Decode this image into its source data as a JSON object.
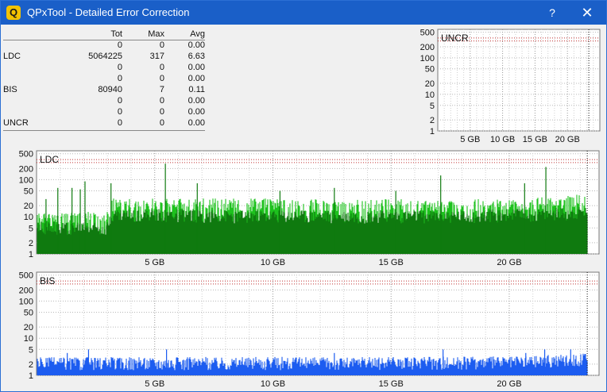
{
  "window": {
    "title": "QPxTool - Detailed Error Correction",
    "app_icon_glyph": "Q",
    "help_glyph": "?",
    "close_glyph": "✕",
    "titlebar_color": "#1a5fc8"
  },
  "stats": {
    "headers": [
      "Tot",
      "Max",
      "Avg"
    ],
    "rows": [
      {
        "label": "",
        "tot": "0",
        "max": "0",
        "avg": "0.00"
      },
      {
        "label": "LDC",
        "tot": "5064225",
        "max": "317",
        "avg": "6.63"
      },
      {
        "label": "",
        "tot": "0",
        "max": "0",
        "avg": "0.00"
      },
      {
        "label": "",
        "tot": "0",
        "max": "0",
        "avg": "0.00"
      },
      {
        "label": "BIS",
        "tot": "80940",
        "max": "7",
        "avg": "0.11"
      },
      {
        "label": "",
        "tot": "0",
        "max": "0",
        "avg": "0.00"
      },
      {
        "label": "",
        "tot": "0",
        "max": "0",
        "avg": "0.00"
      },
      {
        "label": "UNCR",
        "tot": "0",
        "max": "0",
        "avg": "0.00"
      }
    ]
  },
  "chart_data": [
    {
      "id": "uncr",
      "type": "area",
      "title": "UNCR",
      "y_scale": "log",
      "y_ticks": [
        "1",
        "2",
        "5",
        "10",
        "20",
        "50",
        "100",
        "200",
        "500"
      ],
      "x_ticks": [
        "5 GB",
        "10 GB",
        "15 GB",
        "20 GB"
      ],
      "x_unit": "GB",
      "x_range": [
        0,
        25
      ],
      "disc_end_gb": 23.3,
      "series": [
        {
          "values": [],
          "color": "#1aa31a"
        }
      ]
    },
    {
      "id": "ldc",
      "type": "area",
      "title": "LDC",
      "y_scale": "log",
      "y_ticks": [
        "1",
        "2",
        "5",
        "10",
        "20",
        "50",
        "100",
        "200",
        "500"
      ],
      "x_ticks": [
        "5 GB",
        "10 GB",
        "15 GB",
        "20 GB"
      ],
      "x_unit": "GB",
      "x_range": [
        0,
        23.8
      ],
      "disc_end_gb": 23.3,
      "series": [
        {
          "role": "max",
          "color": "#1ec21e",
          "x": [
            0,
            1,
            2,
            3,
            3.2,
            4,
            6,
            8,
            10,
            12,
            14,
            16,
            18,
            20,
            21,
            22,
            23,
            23.3
          ],
          "values": [
            10,
            10,
            11,
            11,
            25,
            25,
            25,
            25,
            25,
            25,
            25,
            24,
            24,
            24,
            26,
            28,
            32,
            34
          ]
        },
        {
          "role": "avg",
          "color": "#0f7a0f",
          "x": [
            0,
            1,
            2,
            3,
            3.2,
            4,
            6,
            8,
            10,
            12,
            14,
            16,
            18,
            20,
            21,
            22,
            23,
            23.3
          ],
          "values": [
            6,
            6,
            6,
            6,
            13,
            13,
            13,
            12,
            12,
            12,
            12,
            12,
            12,
            13,
            13,
            14,
            15,
            15
          ]
        }
      ],
      "spikes": [
        {
          "x": 0.4,
          "value": 30
        },
        {
          "x": 0.9,
          "value": 60
        },
        {
          "x": 1.5,
          "value": 60
        },
        {
          "x": 1.85,
          "value": 55
        },
        {
          "x": 2.05,
          "value": 90
        },
        {
          "x": 3.15,
          "value": 80
        },
        {
          "x": 5.45,
          "value": 270
        },
        {
          "x": 6.8,
          "value": 80
        },
        {
          "x": 10.3,
          "value": 50
        },
        {
          "x": 12.6,
          "value": 60
        },
        {
          "x": 15.2,
          "value": 50
        },
        {
          "x": 17.1,
          "value": 130
        },
        {
          "x": 20.65,
          "value": 80
        },
        {
          "x": 21.55,
          "value": 220
        }
      ]
    },
    {
      "id": "bis",
      "type": "area",
      "title": "BIS",
      "y_scale": "log",
      "y_ticks": [
        "1",
        "2",
        "5",
        "10",
        "20",
        "50",
        "100",
        "200",
        "500"
      ],
      "x_ticks": [
        "5 GB",
        "10 GB",
        "15 GB",
        "20 GB"
      ],
      "x_unit": "GB",
      "x_range": [
        0,
        23.8
      ],
      "disc_end_gb": 23.3,
      "series": [
        {
          "color": "#1c5cf0",
          "x": [
            0,
            5,
            10,
            15,
            20,
            22,
            23.3
          ],
          "values": [
            2.5,
            2.5,
            2.5,
            2.5,
            2.6,
            3,
            3.2
          ]
        }
      ],
      "spikes": [
        {
          "x": 1.3,
          "value": 4
        },
        {
          "x": 2.2,
          "value": 5
        },
        {
          "x": 5.5,
          "value": 5
        },
        {
          "x": 12.6,
          "value": 4
        },
        {
          "x": 17.2,
          "value": 5
        },
        {
          "x": 20.7,
          "value": 4
        },
        {
          "x": 21.5,
          "value": 5
        },
        {
          "x": 22.6,
          "value": 5
        }
      ]
    }
  ]
}
